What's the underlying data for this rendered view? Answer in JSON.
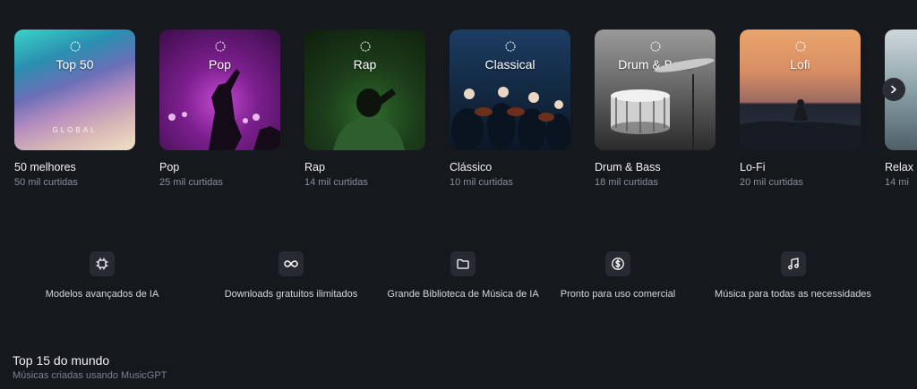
{
  "playlists": [
    {
      "cover_title": "Top 50",
      "cover_sub": "GLOBAL",
      "name": "50 melhores",
      "likes": "50 mil curtidas"
    },
    {
      "cover_title": "Pop",
      "cover_sub": "",
      "name": "Pop",
      "likes": "25 mil curtidas"
    },
    {
      "cover_title": "Rap",
      "cover_sub": "",
      "name": "Rap",
      "likes": "14 mil curtidas"
    },
    {
      "cover_title": "Classical",
      "cover_sub": "",
      "name": "Clássico",
      "likes": "10 mil curtidas"
    },
    {
      "cover_title": "Drum & Bass",
      "cover_sub": "",
      "name": "Drum & Bass",
      "likes": "18 mil curtidas"
    },
    {
      "cover_title": "Lofi",
      "cover_sub": "",
      "name": "Lo-Fi",
      "likes": "20 mil curtidas"
    },
    {
      "cover_title": "",
      "cover_sub": "",
      "name": "Relax",
      "likes": "14 mi"
    }
  ],
  "features": [
    {
      "icon": "cpu-icon",
      "label": "Modelos avançados de IA"
    },
    {
      "icon": "infinity-icon",
      "label": "Downloads gratuitos ilimitados"
    },
    {
      "icon": "folder-icon",
      "label": "Grande Biblioteca de Música de IA"
    },
    {
      "icon": "dollar-circle-icon",
      "label": "Pronto para uso comercial"
    },
    {
      "icon": "music-note-icon",
      "label": "Música para todas as necessidades"
    }
  ],
  "section": {
    "title": "Top 15 do mundo",
    "subtitle": "Músicas criadas usando MusicGPT"
  }
}
